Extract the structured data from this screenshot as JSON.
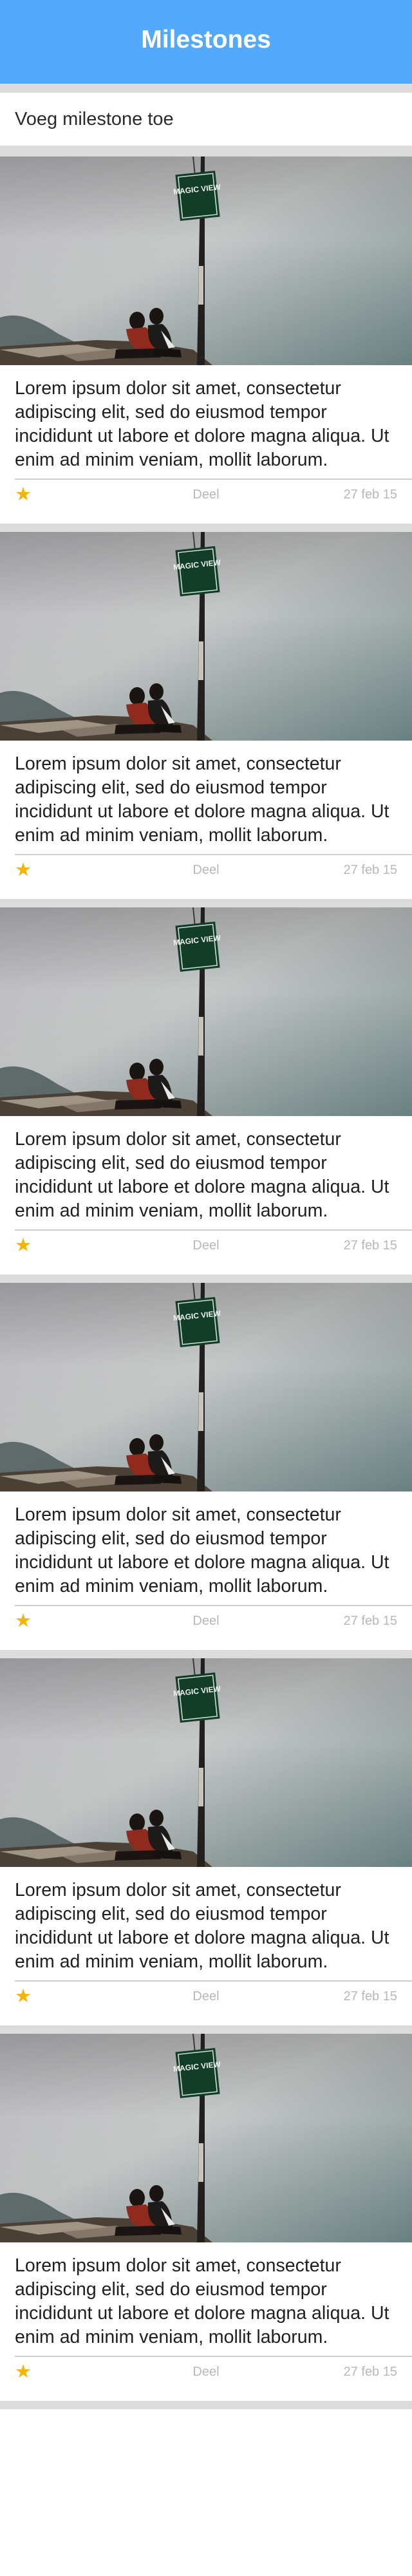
{
  "header": {
    "title": "Milestones"
  },
  "add_milestone": {
    "label": "Voeg milestone toe"
  },
  "milestones": [
    {
      "text": "Lorem ipsum dolor sit amet, consectetur adipiscing elit, sed do eiusmod tempor incididunt ut labore et dolore magna aliqua. Ut enim ad minim veniam, mollit laborum.",
      "share_label": "Deel",
      "date": "27 feb 15",
      "starred": true,
      "photo_sign_text": "MAGIC VIEW"
    },
    {
      "text": "Lorem ipsum dolor sit amet, consectetur adipiscing elit, sed do eiusmod tempor incididunt ut labore et dolore magna aliqua. Ut enim ad minim veniam, mollit laborum.",
      "share_label": "Deel",
      "date": "27 feb 15",
      "starred": true,
      "photo_sign_text": "MAGIC VIEW"
    },
    {
      "text": "Lorem ipsum dolor sit amet, consectetur adipiscing elit, sed do eiusmod tempor incididunt ut labore et dolore magna aliqua. Ut enim ad minim veniam, mollit laborum.",
      "share_label": "Deel",
      "date": "27 feb 15",
      "starred": true,
      "photo_sign_text": "MAGIC VIEW"
    },
    {
      "text": "Lorem ipsum dolor sit amet, consectetur adipiscing elit, sed do eiusmod tempor incididunt ut labore et dolore magna aliqua. Ut enim ad minim veniam, mollit laborum.",
      "share_label": "Deel",
      "date": "27 feb 15",
      "starred": true,
      "photo_sign_text": "MAGIC VIEW"
    },
    {
      "text": "Lorem ipsum dolor sit amet, consectetur adipiscing elit, sed do eiusmod tempor incididunt ut labore et dolore magna aliqua. Ut enim ad minim veniam, mollit laborum.",
      "share_label": "Deel",
      "date": "27 feb 15",
      "starred": true,
      "photo_sign_text": "MAGIC VIEW"
    },
    {
      "text": "Lorem ipsum dolor sit amet, consectetur adipiscing elit, sed do eiusmod tempor incididunt ut labore et dolore magna aliqua. Ut enim ad minim veniam, mollit laborum.",
      "share_label": "Deel",
      "date": "27 feb 15",
      "starred": true,
      "photo_sign_text": "MAGIC VIEW"
    }
  ],
  "icons": {
    "star": "star-icon"
  },
  "colors": {
    "header_bg": "#53aafc",
    "star": "#f4b400",
    "separator": "#dcdcdc"
  }
}
